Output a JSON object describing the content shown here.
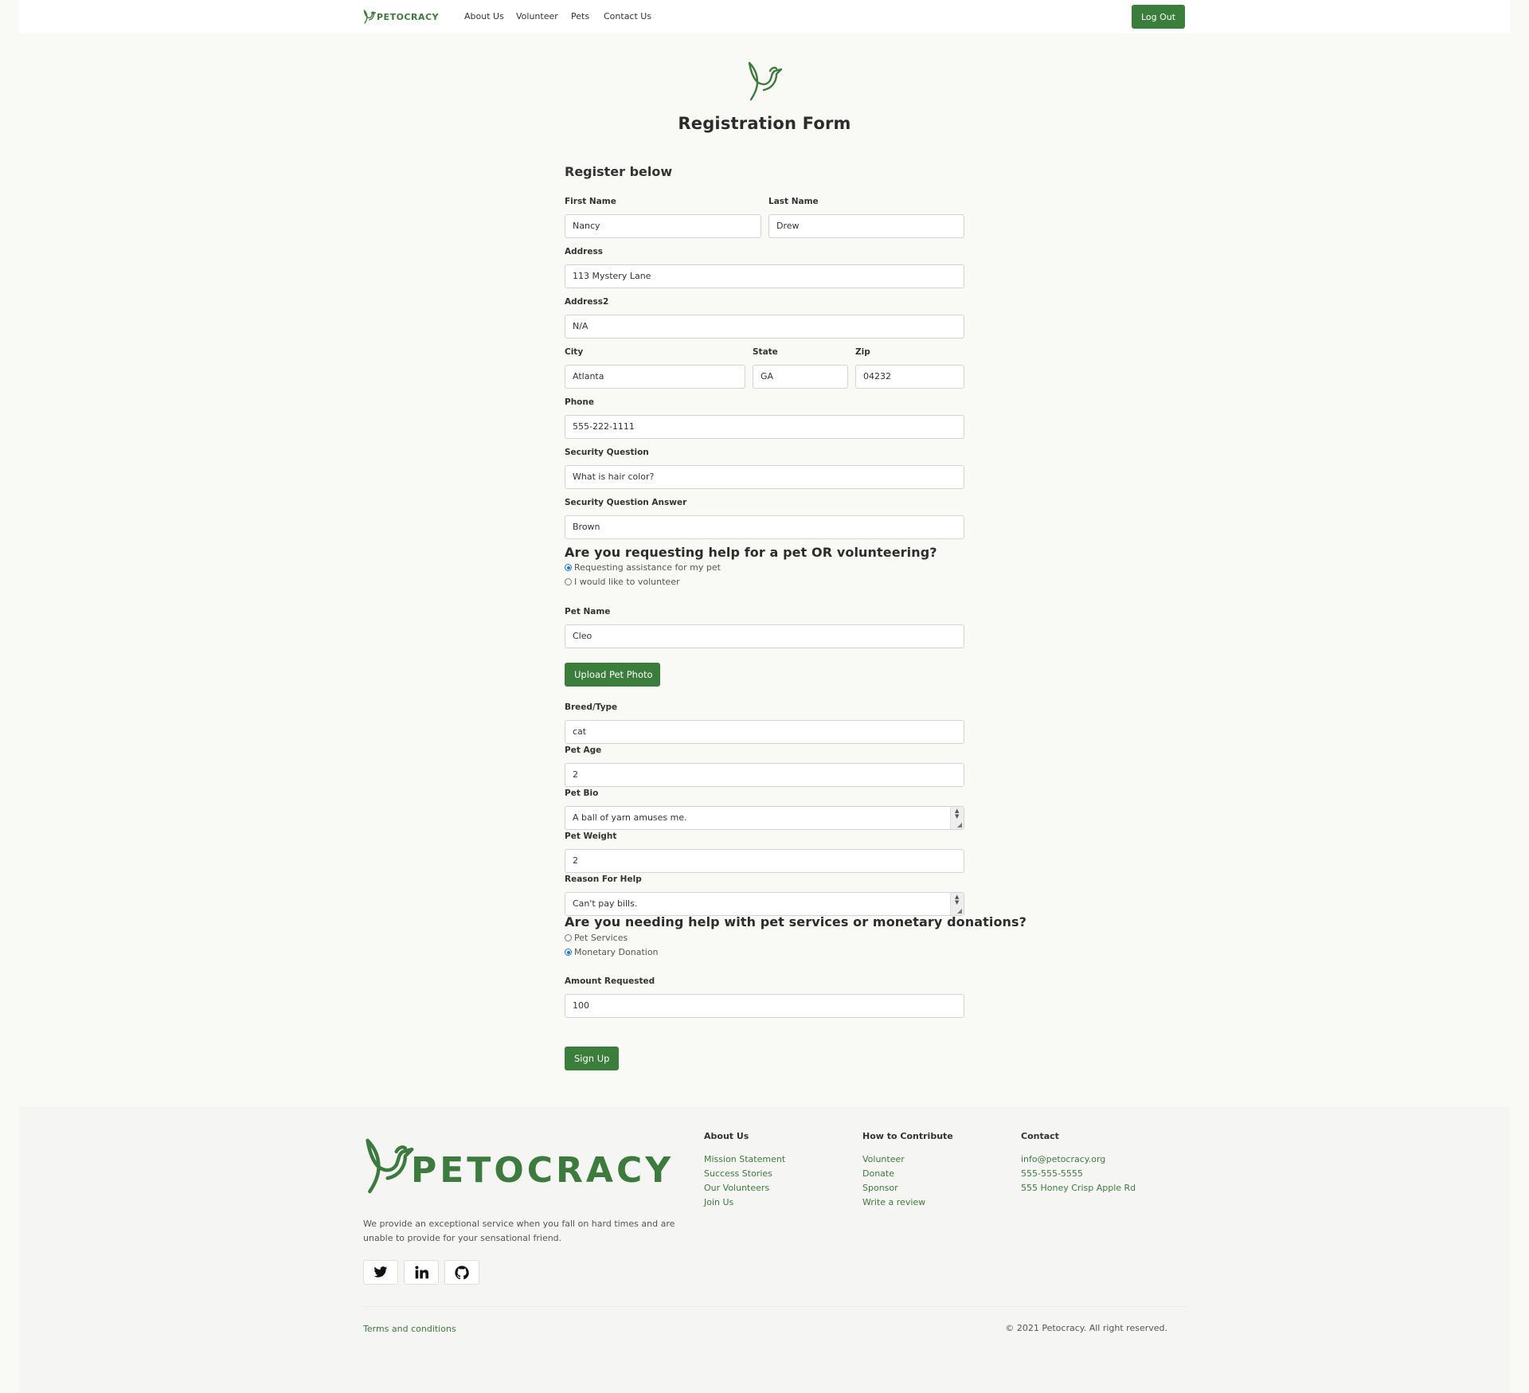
{
  "nav": {
    "brand": "PETOCRACY",
    "links": [
      "About Us",
      "Volunteer",
      "Pets",
      "Contact Us"
    ],
    "logout_label": "Log Out"
  },
  "header": {
    "title": "Registration Form"
  },
  "form": {
    "subtitle": "Register below",
    "first_name": {
      "label": "First Name",
      "value": "Nancy"
    },
    "last_name": {
      "label": "Last Name",
      "value": "Drew"
    },
    "address": {
      "label": "Address",
      "value": "113 Mystery Lane"
    },
    "address2": {
      "label": "Address2",
      "value": "N/A"
    },
    "city": {
      "label": "City",
      "value": "Atlanta"
    },
    "state": {
      "label": "State",
      "value": "GA"
    },
    "zip": {
      "label": "Zip",
      "value": "04232"
    },
    "phone": {
      "label": "Phone",
      "value": "555-222-1111"
    },
    "security_question": {
      "label": "Security Question",
      "value": "What is hair color?"
    },
    "security_answer": {
      "label": "Security Question Answer",
      "value": "Brown"
    },
    "role_question": "Are you requesting help for a pet OR volunteering?",
    "role_options": [
      {
        "label": "Requesting assistance for my pet",
        "checked": true
      },
      {
        "label": "I would like to volunteer",
        "checked": false
      }
    ],
    "pet_name": {
      "label": "Pet Name",
      "value": "Cleo"
    },
    "upload_label": "Upload Pet Photo",
    "breed": {
      "label": "Breed/Type",
      "value": "cat"
    },
    "pet_age": {
      "label": "Pet Age",
      "value": "2"
    },
    "pet_bio": {
      "label": "Pet Bio",
      "value": "A ball of yarn amuses me."
    },
    "pet_weight": {
      "label": "Pet Weight",
      "value": "2"
    },
    "reason": {
      "label": "Reason For Help",
      "value": "Can't pay bills."
    },
    "help_question": "Are you needing help with pet services or monetary donations?",
    "help_options": [
      {
        "label": "Pet Services",
        "checked": false
      },
      {
        "label": "Monetary Donation",
        "checked": true
      }
    ],
    "amount": {
      "label": "Amount Requested",
      "value": "100"
    },
    "submit_label": "Sign Up"
  },
  "footer": {
    "brand": "PETOCRACY",
    "description": "We provide an exceptional service when you fall on hard times and are unable to provide for your sensational friend.",
    "columns": [
      {
        "title": "About Us",
        "links": [
          "Mission Statement",
          "Success Stories",
          "Our Volunteers",
          "Join Us"
        ]
      },
      {
        "title": "How to Contribute",
        "links": [
          "Volunteer",
          "Donate",
          "Sponsor",
          "Write a review"
        ]
      },
      {
        "title": "Contact",
        "links": [
          "info@petocracy.org",
          "555-555-5555",
          "555 Honey Crisp Apple Rd"
        ]
      }
    ],
    "social_icons": [
      "twitter-icon",
      "linkedin-icon",
      "github-icon"
    ],
    "terms": "Terms and conditions",
    "copyright": "© 2021 Petocracy. All right reserved."
  },
  "colors": {
    "brand_green": "#3b7e3b",
    "background": "#f9f9f5",
    "radio_blue": "#1a73e8"
  }
}
